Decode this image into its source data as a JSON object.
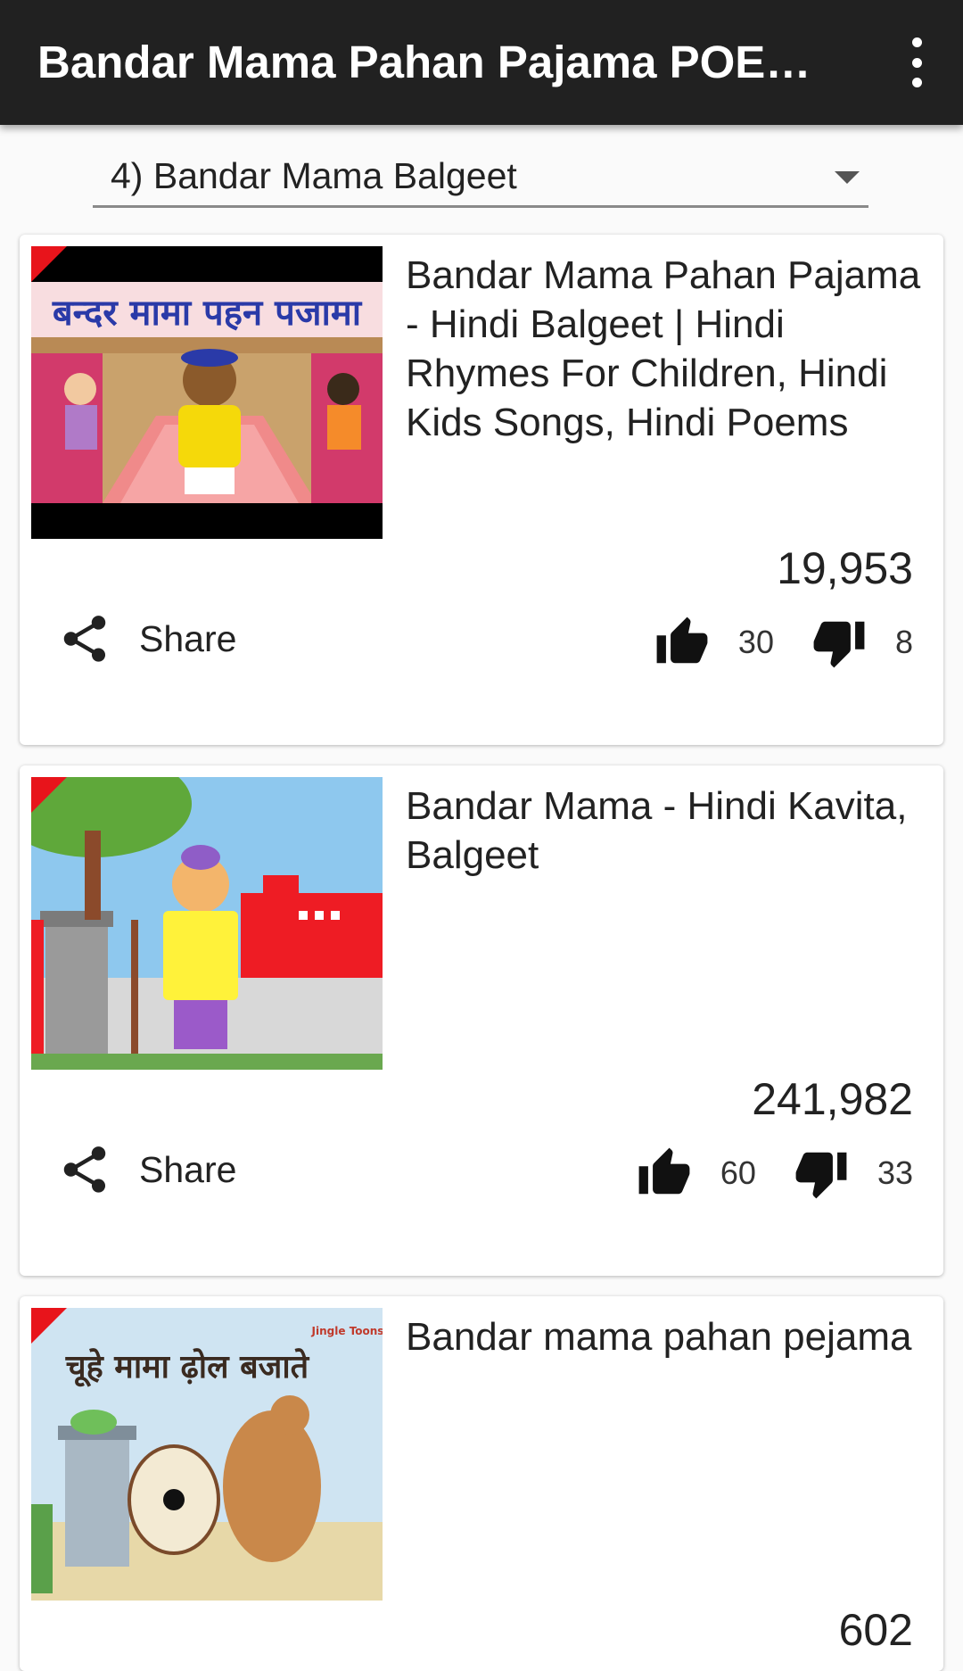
{
  "appbar": {
    "title": "Bandar Mama Pahan Pajama POEM...",
    "menu_icon": "more-vert-icon"
  },
  "spinner": {
    "selected": "4) Bandar Mama Balgeet"
  },
  "videos": [
    {
      "title": "Bandar Mama Pahan Pajama - Hindi Balgeet | Hindi Rhymes For Children, Hindi Kids Songs, Hindi Poems",
      "thumb_caption": "बन्दर मामा पहन पजामा",
      "views": "19,953",
      "share_label": "Share",
      "likes": "30",
      "dislikes": "8"
    },
    {
      "title": "Bandar Mama  - Hindi Kavita, Balgeet",
      "views": "241,982",
      "share_label": "Share",
      "likes": "60",
      "dislikes": "33"
    },
    {
      "title": "Bandar mama pahan pejama",
      "thumb_caption": "चूहे मामा ढ़ोल बजाते",
      "thumb_logo": "Jingle Toons",
      "views": "602"
    }
  ],
  "colors": {
    "appbar": "#212121",
    "accent_corner": "#e8141b",
    "background": "#fafafa"
  }
}
